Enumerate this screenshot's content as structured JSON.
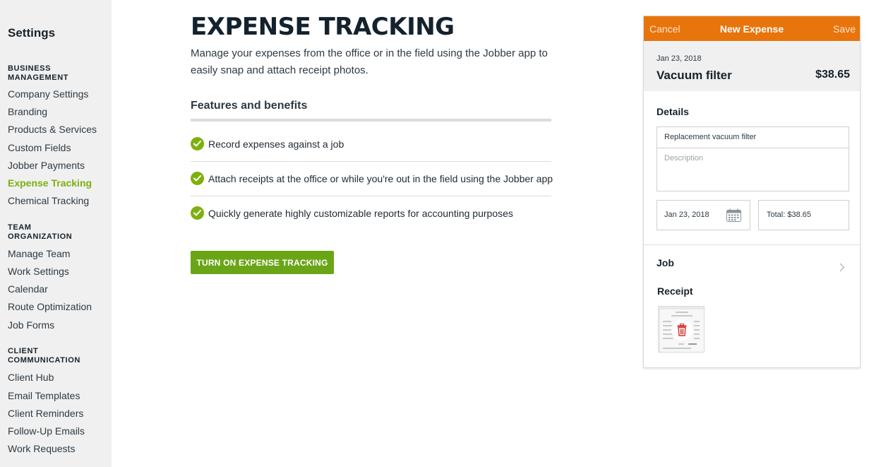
{
  "sidebar": {
    "title": "Settings",
    "sections": [
      {
        "heading_line1": "BUSINESS",
        "heading_line2": "MANAGEMENT",
        "items": [
          "Company Settings",
          "Branding",
          "Products & Services",
          "Custom Fields",
          "Jobber Payments",
          "Expense Tracking",
          "Chemical Tracking"
        ]
      },
      {
        "heading_line1": "TEAM",
        "heading_line2": "ORGANIZATION",
        "items": [
          "Manage Team",
          "Work Settings",
          "Calendar",
          "Route Optimization",
          "Job Forms"
        ]
      },
      {
        "heading_line1": "CLIENT",
        "heading_line2": "COMMUNICATION",
        "items": [
          "Client Hub",
          "Email Templates",
          "Client Reminders",
          "Follow-Up Emails",
          "Work Requests"
        ]
      }
    ],
    "active_item": "Expense Tracking"
  },
  "main": {
    "title": "EXPENSE TRACKING",
    "description": "Manage your expenses from the office or in the field using the Jobber app to easily snap and attach receipt photos.",
    "features_heading": "Features and benefits",
    "features": [
      "Record expenses against a job",
      "Attach receipts at the office or while you're out in the field using the Jobber app",
      "Quickly generate highly customizable reports for accounting purposes"
    ],
    "cta_label": "TURN ON EXPENSE TRACKING"
  },
  "mockup": {
    "cancel_label": "Cancel",
    "title": "New Expense",
    "save_label": "Save",
    "date": "Jan 23, 2018",
    "item_name": "Vacuum filter",
    "amount": "$38.65",
    "details_heading": "Details",
    "name_field_value": "Replacement vacuum filter",
    "description_placeholder": "Description",
    "date_field_value": "Jan 23, 2018",
    "total_value": "Total: $38.65",
    "job_label": "Job",
    "receipt_label": "Receipt"
  },
  "colors": {
    "accent_green": "#7db00e",
    "button_green": "#6aa517",
    "header_orange": "#e8740c",
    "trash_red": "#d0312d"
  },
  "icons": [
    "check-circle-icon",
    "calendar-icon",
    "chevron-right-icon",
    "trash-icon"
  ]
}
